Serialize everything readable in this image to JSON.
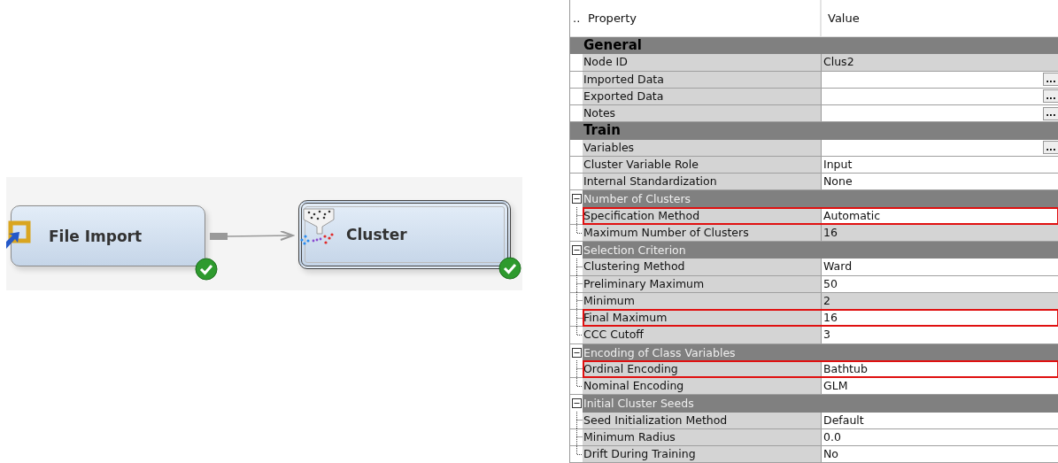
{
  "diagram": {
    "nodes": [
      {
        "label": "File Import",
        "kind": "import",
        "selected": false,
        "done": true
      },
      {
        "label": "Cluster",
        "kind": "cluster",
        "selected": true,
        "done": true
      }
    ]
  },
  "properties": {
    "header": {
      "marker": "..",
      "property": "Property",
      "value": "Value"
    },
    "sections": [
      {
        "title": "General",
        "items": [
          {
            "kind": "property",
            "name": "Node ID",
            "value": "Clus2",
            "editable": false,
            "highlighted": false
          },
          {
            "kind": "property",
            "name": "Imported Data",
            "value": "",
            "editable": true,
            "highlighted": false,
            "browse": "..."
          },
          {
            "kind": "property",
            "name": "Exported Data",
            "value": "",
            "editable": true,
            "highlighted": false,
            "browse": "..."
          },
          {
            "kind": "property",
            "name": "Notes",
            "value": "",
            "editable": true,
            "highlighted": false,
            "browse": "..."
          }
        ]
      },
      {
        "title": "Train",
        "items": [
          {
            "kind": "property",
            "name": "Variables",
            "value": "",
            "editable": true,
            "highlighted": false,
            "browse": "..."
          },
          {
            "kind": "property",
            "name": "Cluster Variable Role",
            "value": "Input",
            "editable": true,
            "highlighted": false
          },
          {
            "kind": "property",
            "name": "Internal Standardization",
            "value": "None",
            "editable": true,
            "highlighted": false
          },
          {
            "kind": "group",
            "name": "Number of Clusters",
            "expanded": true,
            "children": [
              {
                "kind": "property",
                "name": "Specification Method",
                "value": "Automatic",
                "editable": true,
                "highlighted": true
              },
              {
                "kind": "property",
                "name": "Maximum Number of Clusters",
                "value": "16",
                "editable": false,
                "highlighted": false
              }
            ]
          },
          {
            "kind": "group",
            "name": "Selection Criterion",
            "expanded": true,
            "children": [
              {
                "kind": "property",
                "name": "Clustering Method",
                "value": "Ward",
                "editable": true,
                "highlighted": false
              },
              {
                "kind": "property",
                "name": "Preliminary Maximum",
                "value": "50",
                "editable": true,
                "highlighted": false
              },
              {
                "kind": "property",
                "name": "Minimum",
                "value": "2",
                "editable": false,
                "highlighted": false
              },
              {
                "kind": "property",
                "name": "Final Maximum",
                "value": "16",
                "editable": true,
                "highlighted": true
              },
              {
                "kind": "property",
                "name": "CCC Cutoff",
                "value": "3",
                "editable": true,
                "highlighted": false
              }
            ]
          },
          {
            "kind": "group",
            "name": "Encoding of Class Variables",
            "expanded": true,
            "children": [
              {
                "kind": "property",
                "name": "Ordinal Encoding",
                "value": "Bathtub",
                "editable": true,
                "highlighted": true
              },
              {
                "kind": "property",
                "name": "Nominal Encoding",
                "value": "GLM",
                "editable": true,
                "highlighted": false
              }
            ]
          },
          {
            "kind": "group",
            "name": "Initial Cluster Seeds",
            "expanded": true,
            "children": [
              {
                "kind": "property",
                "name": "Seed Initialization Method",
                "value": "Default",
                "editable": true,
                "highlighted": false
              },
              {
                "kind": "property",
                "name": "Minimum Radius",
                "value": "0.0",
                "editable": true,
                "highlighted": false
              },
              {
                "kind": "property",
                "name": "Drift During Training",
                "value": "No",
                "editable": true,
                "highlighted": false
              }
            ]
          }
        ]
      }
    ]
  }
}
